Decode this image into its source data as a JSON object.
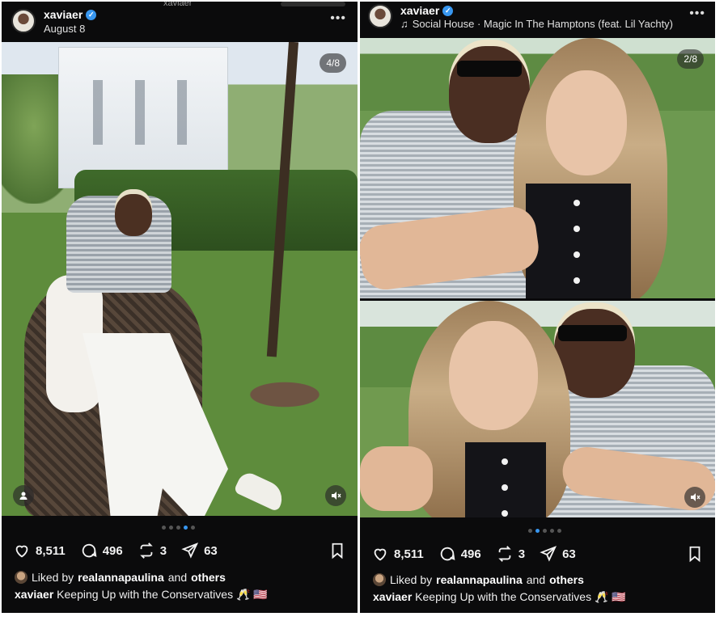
{
  "left_post": {
    "header": {
      "username": "xaviaer",
      "date": "August 8",
      "top_clipped_text": "xaviaer"
    },
    "media": {
      "counter": "4/8",
      "tag_icon": "user-tag-icon",
      "mute_icon": "speaker-muted-icon"
    },
    "carousel": {
      "count": 5,
      "active": 3
    },
    "actions": {
      "likes": "8,511",
      "comments": "496",
      "reposts": "3",
      "shares": "63"
    },
    "liked_by": {
      "prefix": "Liked by",
      "user": "realannapaulina",
      "and": "and",
      "others": "others"
    },
    "caption": {
      "user": "xaviaer",
      "text": "Keeping Up with the Conservatives 🥂 🇺🇸"
    }
  },
  "right_post": {
    "header": {
      "username": "xaviaer",
      "music_icon": "music-note-icon",
      "audio": "Social House · Magic In The Hamptons (feat. Lil Yachty)"
    },
    "media": {
      "counter": "2/8",
      "mute_icon": "speaker-muted-icon"
    },
    "carousel": {
      "count": 5,
      "active": 1
    },
    "actions": {
      "likes": "8,511",
      "comments": "496",
      "reposts": "3",
      "shares": "63"
    },
    "liked_by": {
      "prefix": "Liked by",
      "user": "realannapaulina",
      "and": "and",
      "others": "others"
    },
    "caption": {
      "user": "xaviaer",
      "text": "Keeping Up with the Conservatives 🥂 🇺🇸"
    }
  },
  "colors": {
    "panel_bg": "#0b0b0c",
    "verified": "#3897f0",
    "active_dot": "#3897f0"
  }
}
